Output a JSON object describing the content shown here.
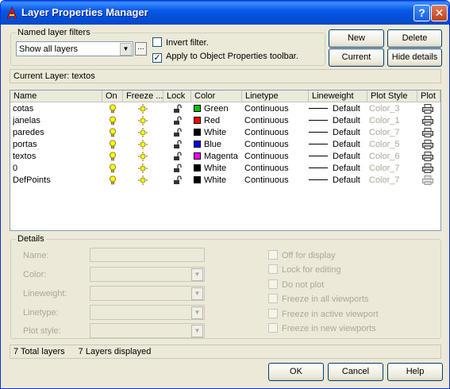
{
  "window": {
    "title": "Layer Properties Manager"
  },
  "filters": {
    "legend": "Named layer filters",
    "selected": "Show all layers",
    "invert_label": "Invert filter.",
    "invert_checked": false,
    "apply_label": "Apply to Object Properties toolbar.",
    "apply_checked": true
  },
  "buttons": {
    "new": "New",
    "delete": "Delete",
    "current": "Current",
    "hide_details": "Hide details",
    "browse": "..."
  },
  "current_layer": "Current Layer:  textos",
  "table": {
    "headers": [
      "Name",
      "On",
      "Freeze ...",
      "Lock",
      "Color",
      "Linetype",
      "Lineweight",
      "Plot Style",
      "Plot"
    ],
    "rows": [
      {
        "name": "cotas",
        "color_name": "Green",
        "color_hex": "#00c000",
        "linetype": "Continuous",
        "lineweight": "Default",
        "plot_style": "Color_3",
        "plot_enabled": true
      },
      {
        "name": "janelas",
        "color_name": "Red",
        "color_hex": "#ff0000",
        "linetype": "Continuous",
        "lineweight": "Default",
        "plot_style": "Color_1",
        "plot_enabled": true
      },
      {
        "name": "paredes",
        "color_name": "White",
        "color_hex": "#000000",
        "linetype": "Continuous",
        "lineweight": "Default",
        "plot_style": "Color_7",
        "plot_enabled": true
      },
      {
        "name": "portas",
        "color_name": "Blue",
        "color_hex": "#0000ff",
        "linetype": "Continuous",
        "lineweight": "Default",
        "plot_style": "Color_5",
        "plot_enabled": true
      },
      {
        "name": "textos",
        "color_name": "Magenta",
        "color_hex": "#ff00ff",
        "linetype": "Continuous",
        "lineweight": "Default",
        "plot_style": "Color_6",
        "plot_enabled": true
      },
      {
        "name": "0",
        "color_name": "White",
        "color_hex": "#000000",
        "linetype": "Continuous",
        "lineweight": "Default",
        "plot_style": "Color_7",
        "plot_enabled": true
      },
      {
        "name": "DefPoints",
        "color_name": "White",
        "color_hex": "#000000",
        "linetype": "Continuous",
        "lineweight": "Default",
        "plot_style": "Color_7",
        "plot_enabled": false
      }
    ]
  },
  "details": {
    "legend": "Details",
    "name_label": "Name:",
    "color_label": "Color:",
    "lineweight_label": "Lineweight:",
    "linetype_label": "Linetype:",
    "plot_style_label": "Plot style:",
    "checks": [
      "Off for display",
      "Lock for editing",
      "Do not plot",
      "Freeze in all viewports",
      "Freeze in active viewport",
      "Freeze in new viewports"
    ]
  },
  "status": {
    "total": "7 Total layers",
    "displayed": "7 Layers displayed"
  },
  "footer": {
    "ok": "OK",
    "cancel": "Cancel",
    "help": "Help"
  },
  "colors": {
    "titlebar": "#0a5fe6",
    "dialog": "#ece9d8",
    "disabled_text": "#aca899"
  }
}
